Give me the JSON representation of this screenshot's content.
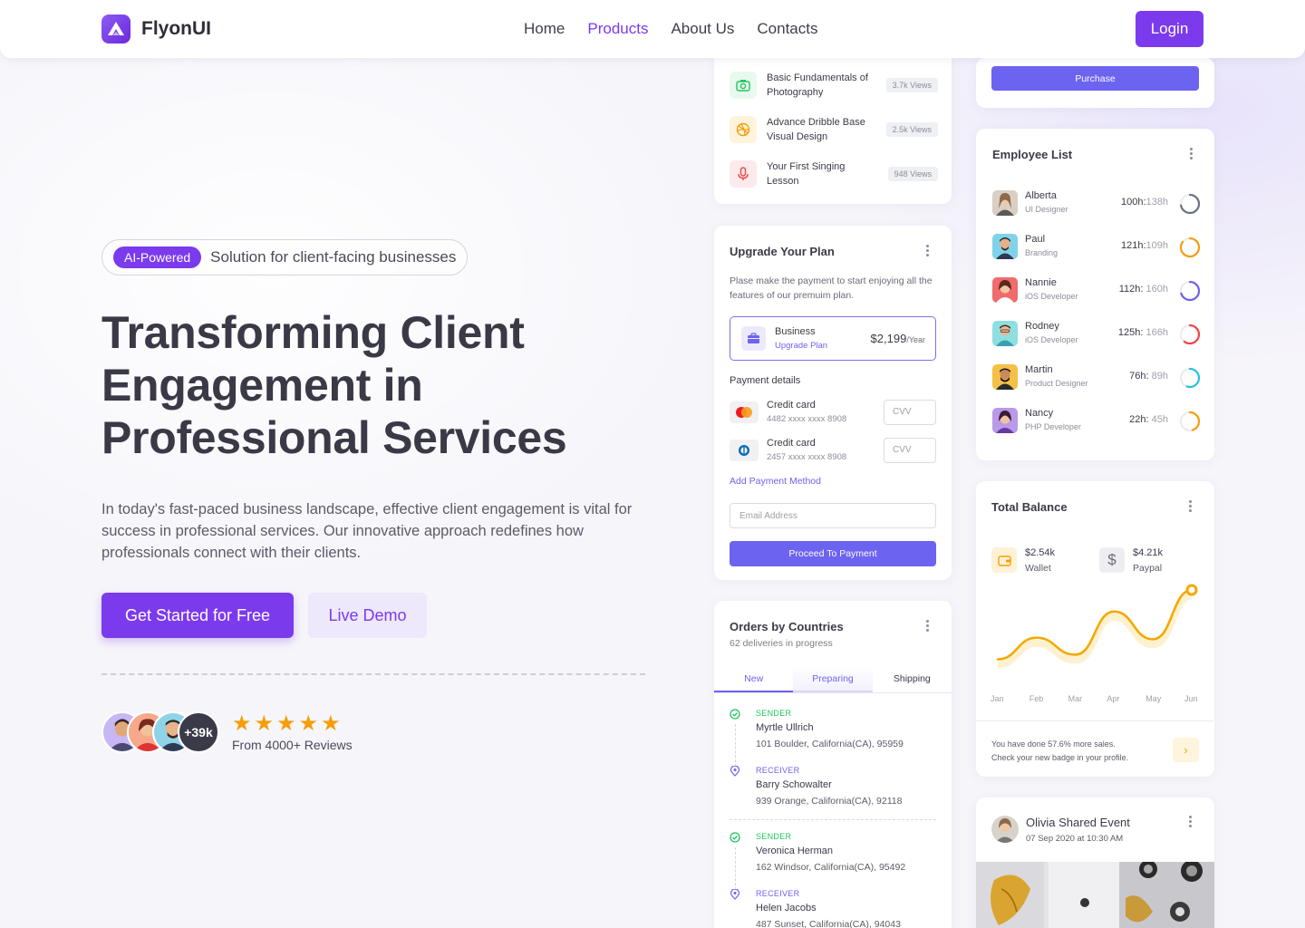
{
  "brand": {
    "name": "FlyonUI"
  },
  "nav": {
    "links": [
      "Home",
      "Products",
      "About Us",
      "Contacts"
    ],
    "active": "Products",
    "login": "Login"
  },
  "hero": {
    "badge": "AI-Powered",
    "tagline": "Solution for client-facing businesses",
    "title_line1": "Transforming Client",
    "title_line2": "Engagement in",
    "title_line3": "Professional Services",
    "description": "In today's fast-paced business landscape, effective client engagement is vital for success in professional services. Our innovative approach redefines how professionals connect with their clients.",
    "cta_primary": "Get Started for Free",
    "cta_secondary": "Live Demo",
    "avatars_more": "+39k",
    "stars": 5,
    "reviews": "From 4000+ Reviews"
  },
  "courses": [
    {
      "name": "Basic Fundamentals of Photography",
      "views": "3.7k Views",
      "icon": "camera-icon",
      "color": "#22c55e"
    },
    {
      "name": "Advance Dribble Base Visual Design",
      "views": "2.5k Views",
      "icon": "dribbble-icon",
      "color": "#f59e0b"
    },
    {
      "name": "Your First Singing Lesson",
      "views": "948 Views",
      "icon": "microphone-icon",
      "color": "#ef4444"
    }
  ],
  "upgrade": {
    "title": "Upgrade Your Plan",
    "description": "Plase make the payment to start enjoying all the features of our premuim plan.",
    "plan_name": "Business",
    "plan_link": "Upgrade Plan",
    "price": "$2,199",
    "period": "/Year",
    "payment_label": "Payment details",
    "cards": [
      {
        "name": "Credit card",
        "number": "4482 xxxx xxxx 8908",
        "cvv_placeholder": "CVV",
        "brand": "mastercard-icon"
      },
      {
        "name": "Credit card",
        "number": "2457 xxxx xxxx 8908",
        "cvv_placeholder": "CVV",
        "brand": "diners-icon"
      }
    ],
    "add_method": "Add Payment Method",
    "email_placeholder": "Email Address",
    "proceed": "Proceed To Payment"
  },
  "orders": {
    "title": "Orders by Countries",
    "subtitle": "62 deliveries in progress",
    "tabs": [
      "New",
      "Preparing",
      "Shipping"
    ],
    "active_tab": "New",
    "entries": [
      {
        "kind": "SENDER",
        "name": "Myrtle Ullrich",
        "address": "101 Boulder, California(CA), 95959"
      },
      {
        "kind": "RECEIVER",
        "name": "Barry Schowalter",
        "address": "939 Orange, California(CA), 92118"
      },
      {
        "kind": "SENDER",
        "name": "Veronica Herman",
        "address": "162  Windsor, California(CA), 95492"
      },
      {
        "kind": "RECEIVER",
        "name": "Helen Jacobs",
        "address": "487 Sunset, California(CA), 94043"
      }
    ]
  },
  "purchase": {
    "label": "Purchase"
  },
  "employees": {
    "title": "Employee List",
    "items": [
      {
        "name": "Alberta",
        "role": "UI Designer",
        "done": "100h",
        "total": "138h",
        "progress": 0.72,
        "color": "#6b7280"
      },
      {
        "name": "Paul",
        "role": "Branding",
        "done": "121h",
        "total": "109h",
        "progress": 0.85,
        "color": "#f59e0b"
      },
      {
        "name": "Nannie",
        "role": "iOS Developer",
        "done": "112h",
        "total": "160h",
        "progress": 0.7,
        "color": "#6c63f0"
      },
      {
        "name": "Rodney",
        "role": "iOS Developer",
        "done": "125h",
        "total": "166h",
        "progress": 0.6,
        "color": "#ef4444"
      },
      {
        "name": "Martin",
        "role": "Product Designer",
        "done": "76h",
        "total": "89h",
        "progress": 0.55,
        "color": "#22c3e6"
      },
      {
        "name": "Nancy",
        "role": "PHP Developer",
        "done": "22h",
        "total": "45h",
        "progress": 0.45,
        "color": "#f59e0b"
      }
    ]
  },
  "balance": {
    "title": "Total Balance",
    "wallet_value": "$2.54k",
    "wallet_label": "Wallet",
    "paypal_value": "$4.21k",
    "paypal_label": "Paypal",
    "note_line1": "You have done 57.6% more sales.",
    "note_line2": "Check your new badge in your profile.",
    "arrow": "›"
  },
  "chart_data": {
    "type": "line",
    "categories": [
      "Jan",
      "Feb",
      "Mar",
      "Apr",
      "May",
      "Jun"
    ],
    "values": [
      10,
      38,
      16,
      72,
      36,
      100
    ],
    "title": "",
    "xlabel": "",
    "ylabel": "",
    "grid": false,
    "color": "#f5a800"
  },
  "event": {
    "title": "Olivia Shared Event",
    "date": "07 Sep 2020 at 10:30 AM"
  }
}
